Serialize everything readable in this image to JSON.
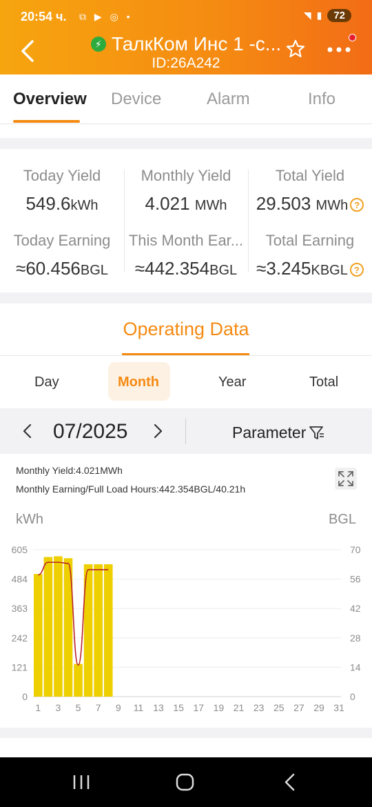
{
  "status_bar": {
    "time": "20:54 ч.",
    "icons": [
      "scan-icon",
      "youtube-icon",
      "chrome-icon",
      "dot-icon"
    ],
    "battery": "72"
  },
  "header": {
    "title": "ТалкКом Инс 1 -с...",
    "device_id": "ID:26A242",
    "status_color": "#2eab3d"
  },
  "tabs": [
    "Overview",
    "Device",
    "Alarm",
    "Info"
  ],
  "stats": [
    {
      "label": "Today Yield",
      "value": "549.6",
      "unit": "kWh",
      "help": false
    },
    {
      "label": "Monthly Yield",
      "value": "4.021",
      "unit": "MWh",
      "help": false
    },
    {
      "label": "Total Yield",
      "value": "29.503",
      "unit": "MWh",
      "help": true
    },
    {
      "label": "Today Earning",
      "value": "≈60.456",
      "unit": "BGL",
      "help": false
    },
    {
      "label": "This Month Ear...",
      "value": "≈442.354",
      "unit": "BGL",
      "help": false
    },
    {
      "label": "Total Earning",
      "value": "≈3.245",
      "unit": "KBGL",
      "help": true
    }
  ],
  "operating": {
    "title": "Operating Data",
    "periods": [
      "Day",
      "Month",
      "Year",
      "Total"
    ],
    "active_period": "Month",
    "date": "07/2025",
    "parameter_label": "Parameter",
    "info_yield": "Monthly Yield:4.021MWh",
    "info_earning": "Monthly Earning/Full Load Hours:442.354BGL/40.21h",
    "left_unit": "kWh",
    "right_unit": "BGL"
  },
  "chart_data": {
    "type": "bar",
    "x_ticks": [
      "1",
      "3",
      "5",
      "7",
      "9",
      "11",
      "13",
      "15",
      "17",
      "19",
      "21",
      "23",
      "25",
      "27",
      "29",
      "31"
    ],
    "y_left_ticks": [
      "0",
      "121",
      "242",
      "363",
      "484",
      "605"
    ],
    "y_right_ticks": [
      "0",
      "14",
      "28",
      "42",
      "56",
      "70"
    ],
    "ylim_left": [
      0,
      605
    ],
    "ylim_right": [
      0,
      70
    ],
    "x_range": [
      1,
      31
    ],
    "bar_color": "#eecf00",
    "line_color": "#b8202a",
    "series": [
      {
        "type": "bar",
        "axis": "left",
        "x": [
          1,
          2,
          3,
          4,
          5,
          6,
          7,
          8
        ],
        "values": [
          505,
          575,
          578,
          570,
          135,
          545,
          545,
          545
        ]
      },
      {
        "type": "line",
        "axis": "right",
        "x": [
          1,
          2,
          3,
          4,
          5,
          6,
          7,
          8
        ],
        "values": [
          58,
          64,
          64,
          63.5,
          15,
          60.5,
          60.5,
          60.5
        ]
      }
    ]
  }
}
